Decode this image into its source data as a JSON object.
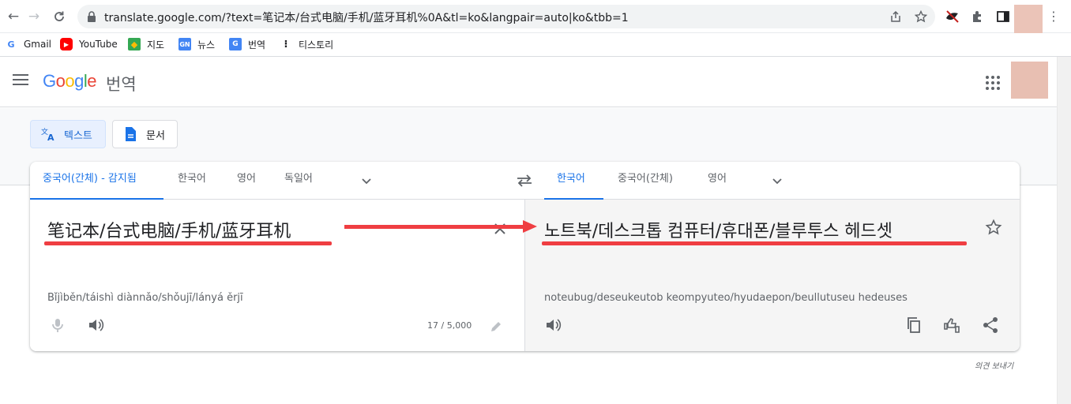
{
  "browser": {
    "url": "translate.google.com/?text=笔记本/台式电脑/手机/蓝牙耳机%0A&tl=ko&langpair=auto|ko&tbb=1",
    "bookmarks": [
      {
        "label": "Gmail",
        "icon": "gmail-icon"
      },
      {
        "label": "YouTube",
        "icon": "youtube-icon"
      },
      {
        "label": "지도",
        "icon": "maps-icon"
      },
      {
        "label": "뉴스",
        "icon": "news-icon"
      },
      {
        "label": "번역",
        "icon": "translate-icon"
      },
      {
        "label": "티스토리",
        "icon": "tistory-icon"
      }
    ]
  },
  "header": {
    "logo": "Google",
    "product": "번역"
  },
  "modes": {
    "text": "텍스트",
    "document": "문서"
  },
  "source_langs": [
    "중국어(간체) - 감지됨",
    "한국어",
    "영어",
    "독일어"
  ],
  "target_langs": [
    "한국어",
    "중국어(간체)",
    "영어"
  ],
  "source": {
    "text": "笔记本/台式电脑/手机/蓝牙耳机",
    "transliteration": "Bǐjìběn/táishì diànnǎo/shǒujī/lányá ěrjī",
    "char_count": "17 / 5,000"
  },
  "target": {
    "text": "노트북/데스크톱 컴퓨터/휴대폰/블루투스 헤드셋",
    "transliteration": "noteubug/deseukeutob keompyuteo/hyudaepon/beullutuseu hedeuses"
  },
  "footer": {
    "feedback": "의견 보내기"
  },
  "colors": {
    "accent": "#1a73e8",
    "annotation_red": "#ef3e42"
  }
}
